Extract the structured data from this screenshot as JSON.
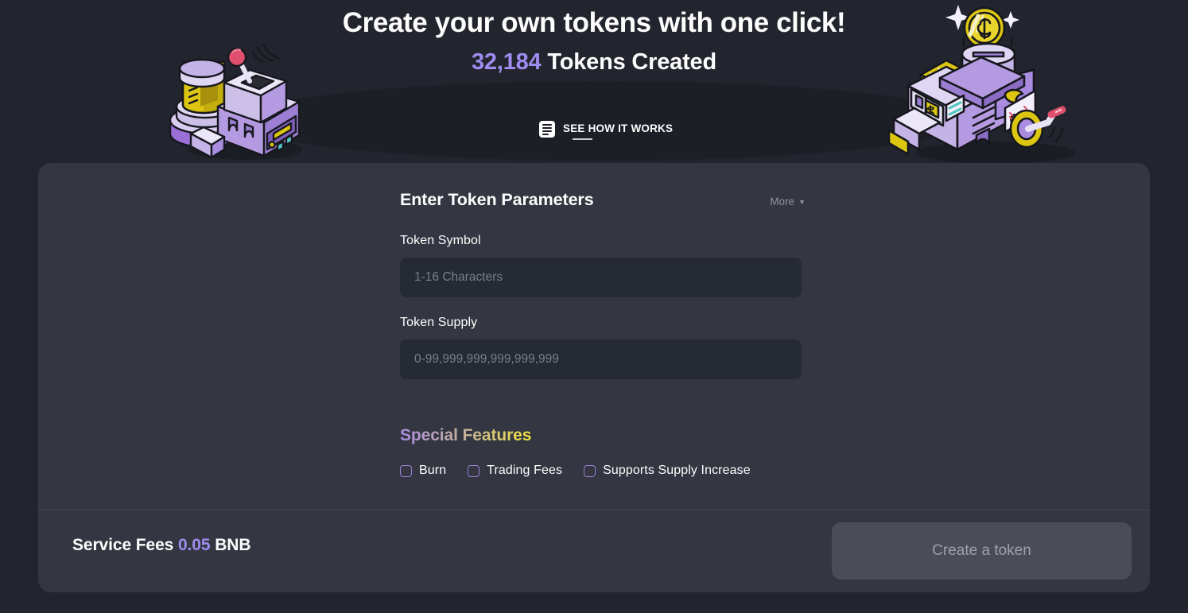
{
  "hero": {
    "title": "Create your own tokens with one click!",
    "count": "32,184",
    "count_suffix": " Tokens Created",
    "how_it_works_label": "SEE HOW IT WORKS",
    "doc_icon": "document-icon"
  },
  "illustrations": {
    "left_alt": "token-machine-illustration",
    "right_alt": "coin-machine-illustration"
  },
  "form": {
    "title": "Enter Token Parameters",
    "more_label": "More",
    "more_caret": "▼",
    "fields": [
      {
        "label": "Token Symbol",
        "placeholder": "1-16 Characters",
        "value": ""
      },
      {
        "label": "Token Supply",
        "placeholder": "0-99,999,999,999,999,999",
        "value": ""
      }
    ],
    "special_features_title_part1": "Special ",
    "special_features_title_part2": "Features",
    "features": [
      {
        "label": "Burn",
        "checked": false
      },
      {
        "label": "Trading Fees",
        "checked": false
      },
      {
        "label": "Supports Supply Increase",
        "checked": false
      }
    ]
  },
  "footer": {
    "service_fees_label": "Service Fees ",
    "service_fees_amount": "0.05",
    "service_fees_currency": " BNB",
    "create_button_label": "Create a token"
  },
  "colors": {
    "page_background": "#23252e",
    "card_background": "#343741",
    "input_background": "#262a33",
    "accent_purple": "#9f8cf0",
    "checkbox_border": "#9b7fd4",
    "accent_yellow": "#f2e23e",
    "muted_text": "#8e93a1",
    "button_disabled_bg": "#4a4d58"
  }
}
